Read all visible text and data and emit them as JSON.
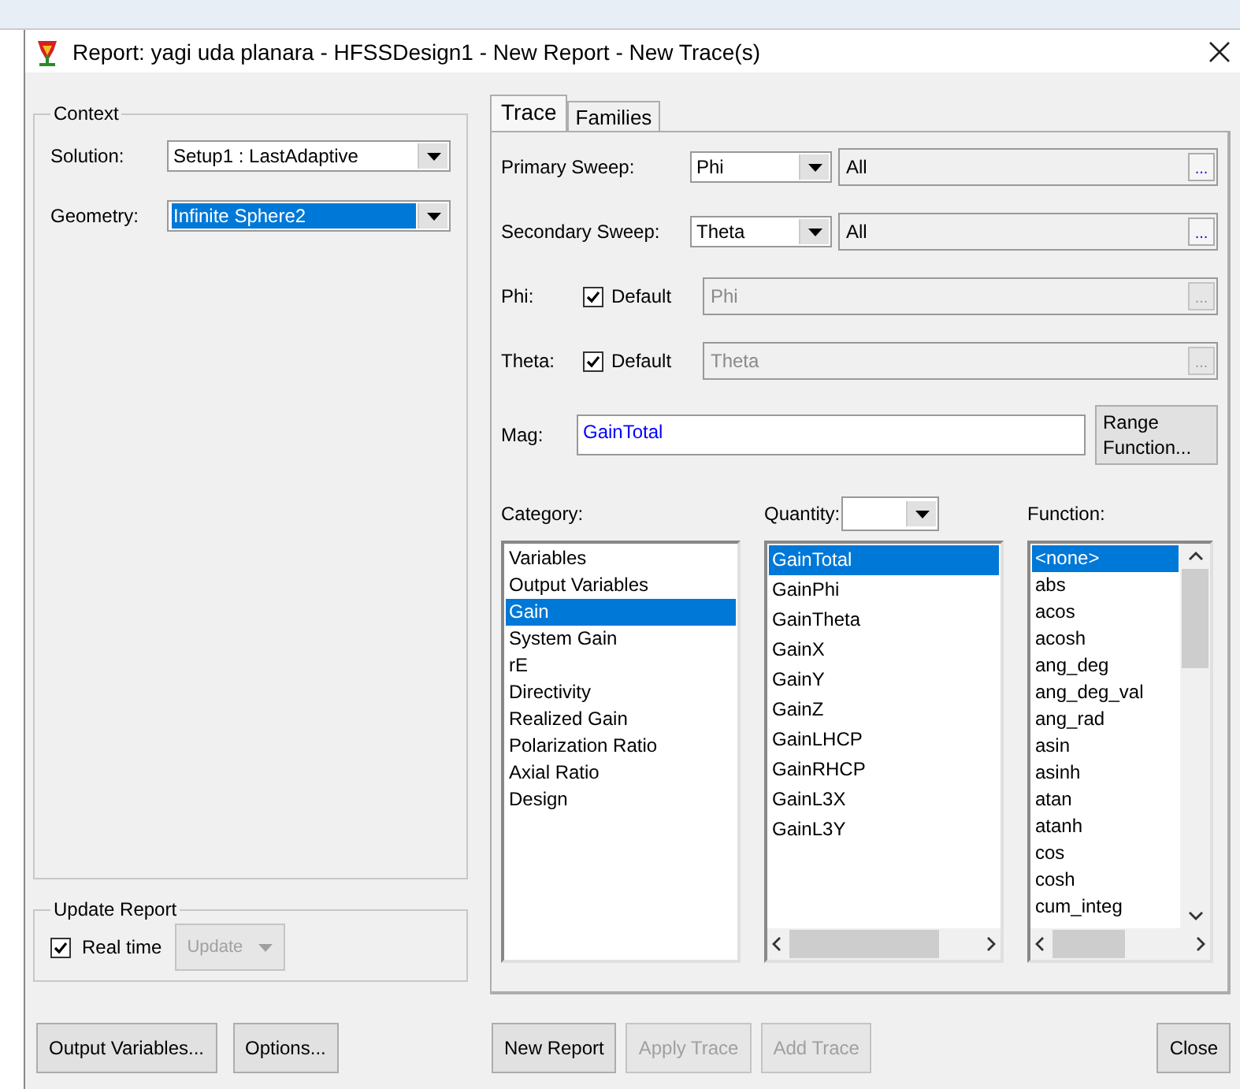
{
  "window": {
    "title": "Report: yagi uda planara - HFSSDesign1 - New Report - New Trace(s)"
  },
  "context": {
    "legend": "Context",
    "solution": {
      "label": "Solution:",
      "value": "Setup1 : LastAdaptive",
      "selected": false
    },
    "geometry": {
      "label": "Geometry:",
      "value": "Infinite Sphere2",
      "selected": true
    }
  },
  "update_report": {
    "legend": "Update Report",
    "realtime": {
      "label": "Real time",
      "checked": true
    },
    "update_button": {
      "label": "Update",
      "disabled": true
    }
  },
  "tabs": [
    {
      "label": "Trace",
      "selected": true
    },
    {
      "label": "Families",
      "selected": false
    }
  ],
  "sweeps": [
    {
      "label": "Primary Sweep:",
      "value": "Phi",
      "range": "All",
      "browse": "..."
    },
    {
      "label": "Secondary Sweep:",
      "value": "Theta",
      "range": "All",
      "browse": "..."
    }
  ],
  "defaults": [
    {
      "label": "Phi:",
      "default_label": "Default",
      "checked": true,
      "value": "Phi",
      "browse": "...",
      "disabled": true
    },
    {
      "label": "Theta:",
      "default_label": "Default",
      "checked": true,
      "value": "Theta",
      "browse": "...",
      "disabled": true
    }
  ],
  "mag": {
    "label": "Mag:",
    "value": "GainTotal"
  },
  "range_function_button": "Range Function...",
  "category": {
    "label": "Category:",
    "items": [
      {
        "label": "Variables",
        "selected": false
      },
      {
        "label": "Output Variables",
        "selected": false
      },
      {
        "label": "Gain",
        "selected": true
      },
      {
        "label": "System Gain",
        "selected": false
      },
      {
        "label": "rE",
        "selected": false
      },
      {
        "label": "Directivity",
        "selected": false
      },
      {
        "label": "Realized Gain",
        "selected": false
      },
      {
        "label": "Polarization Ratio",
        "selected": false
      },
      {
        "label": "Axial Ratio",
        "selected": false
      },
      {
        "label": "Design",
        "selected": false
      }
    ]
  },
  "quantity": {
    "label": "Quantity:",
    "items": [
      {
        "label": "GainTotal",
        "selected": true
      },
      {
        "label": "GainPhi",
        "selected": false
      },
      {
        "label": "GainTheta",
        "selected": false
      },
      {
        "label": "GainX",
        "selected": false
      },
      {
        "label": "GainY",
        "selected": false
      },
      {
        "label": "GainZ",
        "selected": false
      },
      {
        "label": "GainLHCP",
        "selected": false
      },
      {
        "label": "GainRHCP",
        "selected": false
      },
      {
        "label": "GainL3X",
        "selected": false
      },
      {
        "label": "GainL3Y",
        "selected": false
      }
    ]
  },
  "function": {
    "label": "Function:",
    "items": [
      {
        "label": "<none>",
        "selected": true
      },
      {
        "label": "abs",
        "selected": false
      },
      {
        "label": "acos",
        "selected": false
      },
      {
        "label": "acosh",
        "selected": false
      },
      {
        "label": "ang_deg",
        "selected": false
      },
      {
        "label": "ang_deg_val",
        "selected": false
      },
      {
        "label": "ang_rad",
        "selected": false
      },
      {
        "label": "asin",
        "selected": false
      },
      {
        "label": "asinh",
        "selected": false
      },
      {
        "label": "atan",
        "selected": false
      },
      {
        "label": "atanh",
        "selected": false
      },
      {
        "label": "cos",
        "selected": false
      },
      {
        "label": "cosh",
        "selected": false
      },
      {
        "label": "cum_integ",
        "selected": false
      }
    ]
  },
  "left_buttons": [
    {
      "label": "Output Variables...",
      "disabled": false
    },
    {
      "label": "Options...",
      "disabled": false
    }
  ],
  "right_buttons": [
    {
      "label": "New Report",
      "disabled": false
    },
    {
      "label": "Apply Trace",
      "disabled": true
    },
    {
      "label": "Add Trace",
      "disabled": true
    }
  ],
  "close_button": {
    "label": "Close",
    "disabled": false
  }
}
